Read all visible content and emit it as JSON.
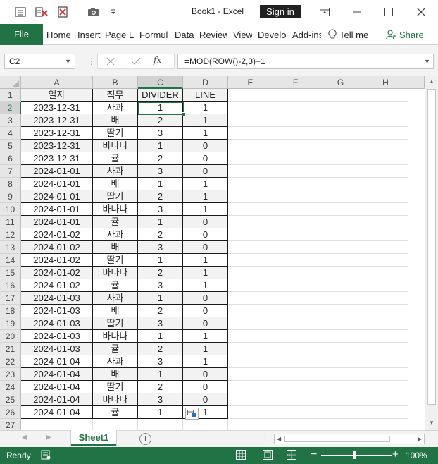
{
  "window": {
    "title": "Book1  -  Excel",
    "signin_label": "Sign in"
  },
  "ribbon": {
    "file_label": "File",
    "tabs": [
      "Home",
      "Insert",
      "Page La",
      "Formula",
      "Data",
      "Review",
      "View",
      "Develop",
      "Add-ins"
    ],
    "tell_me": "Tell me",
    "share": "Share"
  },
  "formula_bar": {
    "name_box": "C2",
    "formula": "=MOD(ROW()-2,3)+1"
  },
  "grid": {
    "columns": [
      "A",
      "B",
      "C",
      "D",
      "E",
      "F",
      "G",
      "H"
    ],
    "selected_column": "C",
    "selected_row": 2,
    "header_row": [
      "일자",
      "직무",
      "DIVIDER",
      "LINE"
    ],
    "rows": [
      [
        "2023-12-31",
        "사과",
        "1",
        "1"
      ],
      [
        "2023-12-31",
        "배",
        "2",
        "1"
      ],
      [
        "2023-12-31",
        "딸기",
        "3",
        "1"
      ],
      [
        "2023-12-31",
        "바나나",
        "1",
        "0"
      ],
      [
        "2023-12-31",
        "귤",
        "2",
        "0"
      ],
      [
        "2024-01-01",
        "사과",
        "3",
        "0"
      ],
      [
        "2024-01-01",
        "배",
        "1",
        "1"
      ],
      [
        "2024-01-01",
        "딸기",
        "2",
        "1"
      ],
      [
        "2024-01-01",
        "바나나",
        "3",
        "1"
      ],
      [
        "2024-01-01",
        "귤",
        "1",
        "0"
      ],
      [
        "2024-01-02",
        "사과",
        "2",
        "0"
      ],
      [
        "2024-01-02",
        "배",
        "3",
        "0"
      ],
      [
        "2024-01-02",
        "딸기",
        "1",
        "1"
      ],
      [
        "2024-01-02",
        "바나나",
        "2",
        "1"
      ],
      [
        "2024-01-02",
        "귤",
        "3",
        "1"
      ],
      [
        "2024-01-03",
        "사과",
        "1",
        "0"
      ],
      [
        "2024-01-03",
        "배",
        "2",
        "0"
      ],
      [
        "2024-01-03",
        "딸기",
        "3",
        "0"
      ],
      [
        "2024-01-03",
        "바나나",
        "1",
        "1"
      ],
      [
        "2024-01-03",
        "귤",
        "2",
        "1"
      ],
      [
        "2024-01-04",
        "사과",
        "3",
        "1"
      ],
      [
        "2024-01-04",
        "배",
        "1",
        "0"
      ],
      [
        "2024-01-04",
        "딸기",
        "2",
        "0"
      ],
      [
        "2024-01-04",
        "바나나",
        "3",
        "0"
      ],
      [
        "2024-01-04",
        "귤",
        "1",
        "1"
      ]
    ],
    "row_numbers": [
      "1",
      "2",
      "3",
      "4",
      "5",
      "6",
      "7",
      "8",
      "9",
      "10",
      "11",
      "12",
      "13",
      "14",
      "15",
      "16",
      "17",
      "18",
      "19",
      "20",
      "21",
      "22",
      "23",
      "24",
      "25",
      "26",
      "27"
    ]
  },
  "sheets": {
    "active": "Sheet1"
  },
  "status": {
    "ready": "Ready",
    "zoom": "100%"
  },
  "colors": {
    "accent": "#217346",
    "error": "#d13438"
  }
}
